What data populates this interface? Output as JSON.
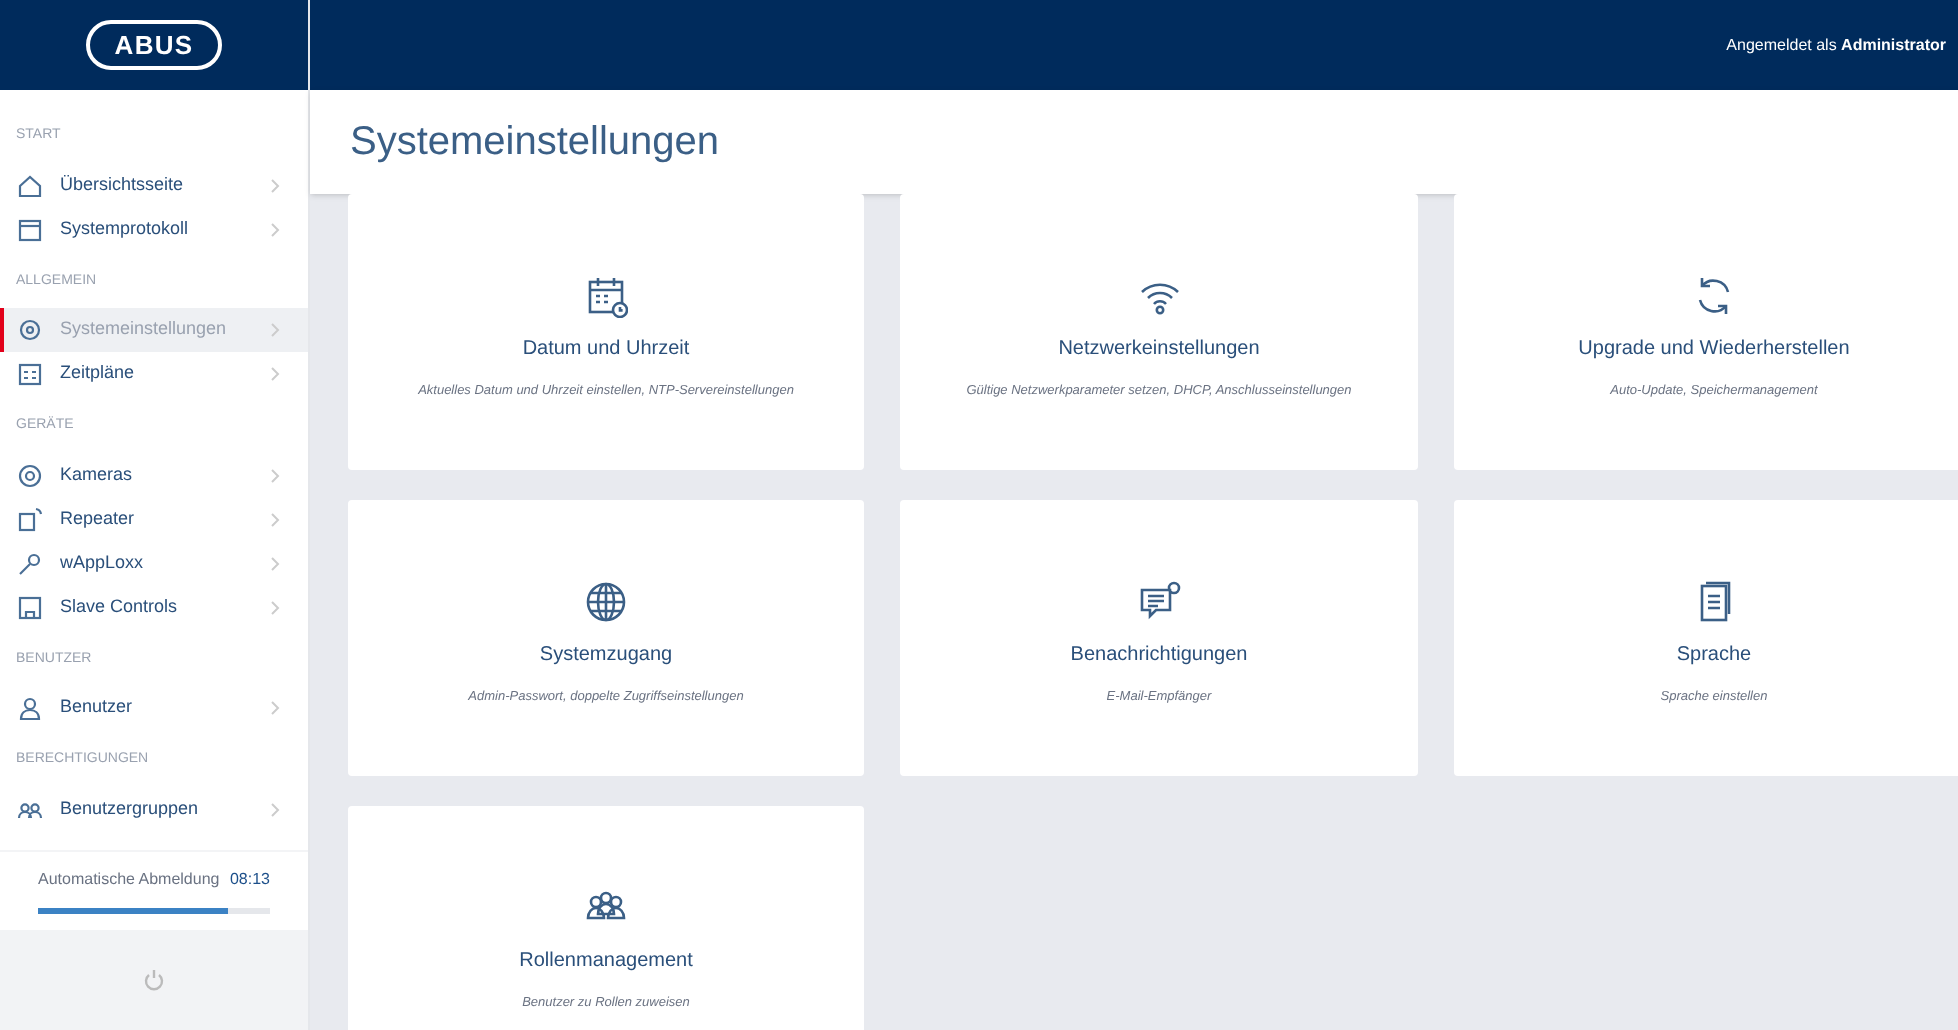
{
  "header": {
    "logo": "ABUS",
    "login_prefix": "Angemeldet als",
    "login_user": "Administrator"
  },
  "sidebar": {
    "sections": [
      {
        "title": "START",
        "items": [
          {
            "label": "Übersichtsseite",
            "selected": false
          },
          {
            "label": "Systemprotokoll",
            "selected": false
          }
        ]
      },
      {
        "title": "ALLGEMEIN",
        "items": [
          {
            "label": "Systemeinstellungen",
            "selected": true
          },
          {
            "label": "Zeitpläne",
            "selected": false
          }
        ]
      },
      {
        "title": "GERÄTE",
        "items": [
          {
            "label": "Kameras",
            "selected": false
          },
          {
            "label": "Repeater",
            "selected": false
          },
          {
            "label": "wAppLoxx",
            "selected": false
          },
          {
            "label": "Slave Controls",
            "selected": false
          }
        ]
      },
      {
        "title": "BENUTZER",
        "items": [
          {
            "label": "Benutzer",
            "selected": false
          }
        ]
      },
      {
        "title": "BERECHTIGUNGEN",
        "items": [
          {
            "label": "Benutzergruppen",
            "selected": false
          }
        ]
      }
    ]
  },
  "auto_logout": {
    "label": "Automatische Abmeldung",
    "time": "08:13",
    "level": 0.82
  },
  "page_title": "Systemeinstellungen",
  "cards": [
    {
      "title": "Datum und Uhrzeit",
      "description": "Aktuelles Datum und Uhrzeit einstellen, NTP-Servereinstellungen"
    },
    {
      "title": "Netzwerkeinstellungen",
      "description": "Gültige Netzwerkparameter setzen, DHCP, Anschlusseinstellungen"
    },
    {
      "title": "Upgrade und Wiederherstellen",
      "description": "Auto-Update, Speichermanagement"
    },
    {
      "title": "Systemzugang",
      "description": "Admin-Passwort, doppelte Zugriffseinstellungen"
    },
    {
      "title": "Benachrichtigungen",
      "description": "E-Mail-Empfänger"
    },
    {
      "title": "Sprache",
      "description": "Sprache einstellen"
    },
    {
      "title": "Rollenmanagement",
      "description": "Benutzer zu Rollen zuweisen"
    }
  ]
}
